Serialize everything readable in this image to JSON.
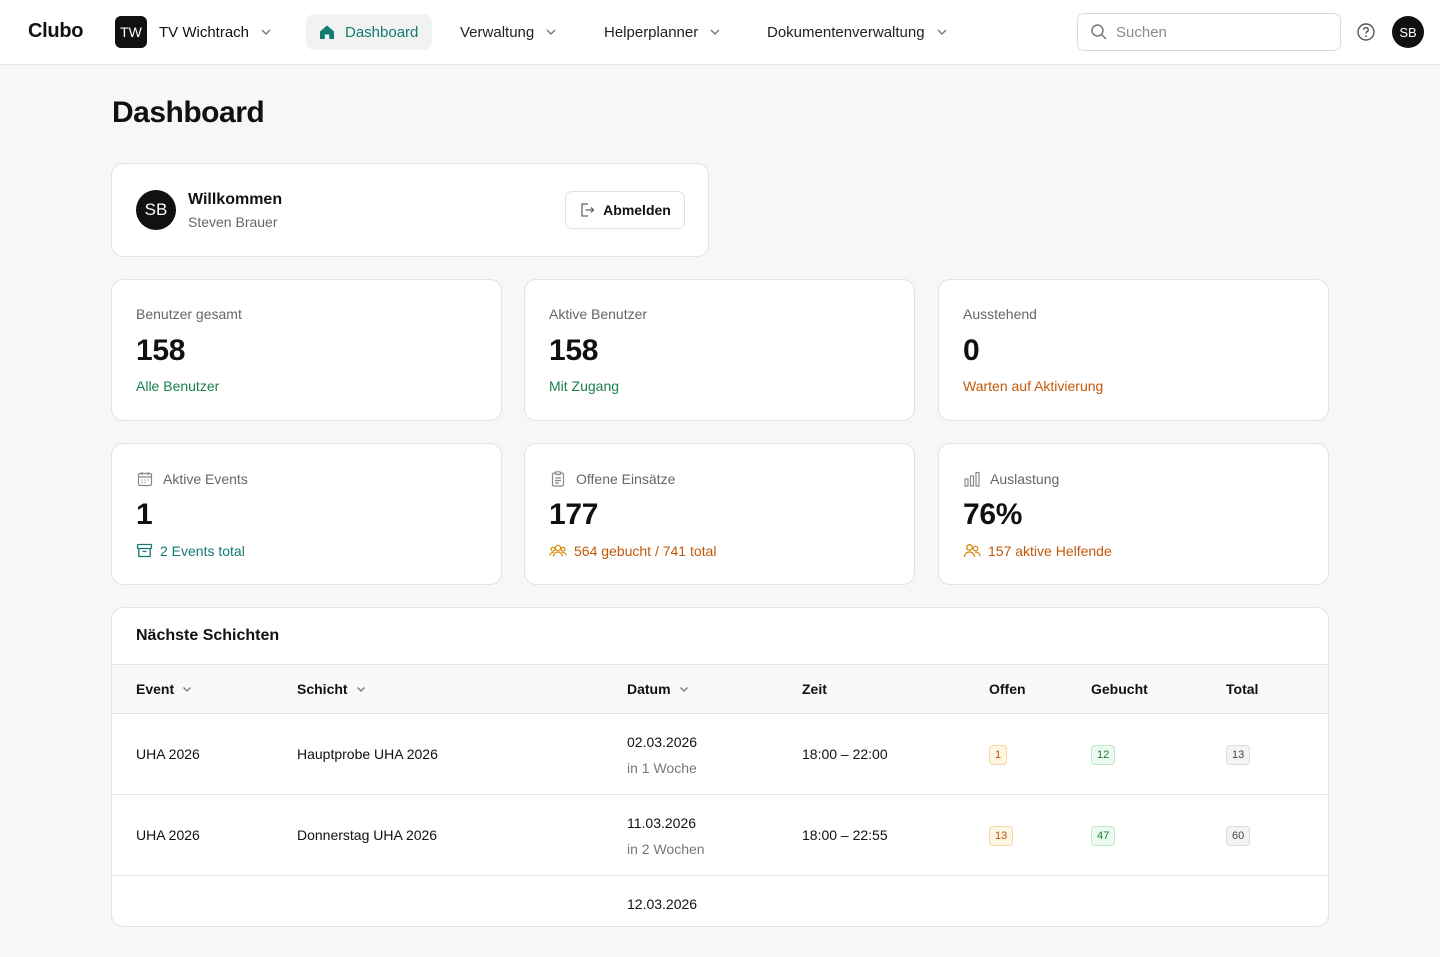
{
  "app": {
    "brand": "Clubo"
  },
  "org": {
    "initials": "TW",
    "name": "TV Wichtrach"
  },
  "nav": {
    "dashboard": "Dashboard",
    "verwaltung": "Verwaltung",
    "helperplanner": "Helperplanner",
    "dokumente": "Dokumentenverwaltung"
  },
  "search": {
    "placeholder": "Suchen"
  },
  "user": {
    "initials": "SB"
  },
  "page": {
    "title": "Dashboard"
  },
  "welcome": {
    "title": "Willkommen",
    "name": "Steven Brauer",
    "initials": "SB",
    "logout_label": "Abmelden"
  },
  "stats": [
    {
      "label": "Benutzer gesamt",
      "value": "158",
      "footer": "Alle Benutzer"
    },
    {
      "label": "Aktive Benutzer",
      "value": "158",
      "footer": "Mit Zugang"
    },
    {
      "label": "Ausstehend",
      "value": "0",
      "footer": "Warten auf Aktivierung"
    },
    {
      "label": "Aktive Events",
      "value": "1",
      "footer": "2 Events total",
      "icon": "calendar-icon",
      "footer_icon": "archive-icon"
    },
    {
      "label": "Offene Einsätze",
      "value": "177",
      "footer": "564 gebucht / 741 total",
      "icon": "clipboard-icon",
      "footer_icon": "users-icon"
    },
    {
      "label": "Auslastung",
      "value": "76%",
      "footer": "157 aktive Helfende",
      "icon": "bar-chart-icon",
      "footer_icon": "users-icon"
    }
  ],
  "colors": {
    "accent": "#147a70",
    "green": "#1a7f4e",
    "orange": "#c2590a",
    "amber": "#d98a0c"
  },
  "shifts": {
    "title": "Nächste Schichten",
    "columns": {
      "event": "Event",
      "shift": "Schicht",
      "date": "Datum",
      "time": "Zeit",
      "open": "Offen",
      "booked": "Gebucht",
      "total": "Total"
    },
    "rows": [
      {
        "event": "UHA 2026",
        "shift": "Hauptprobe UHA 2026",
        "date": "02.03.2026",
        "relative": "in 1 Woche",
        "time": "18:00 – 22:00",
        "open": "1",
        "booked": "12",
        "total": "13"
      },
      {
        "event": "UHA 2026",
        "shift": "Donnerstag UHA 2026",
        "date": "11.03.2026",
        "relative": "in 2 Wochen",
        "time": "18:00 – 22:55",
        "open": "13",
        "booked": "47",
        "total": "60"
      },
      {
        "date": "12.03.2026"
      }
    ]
  }
}
